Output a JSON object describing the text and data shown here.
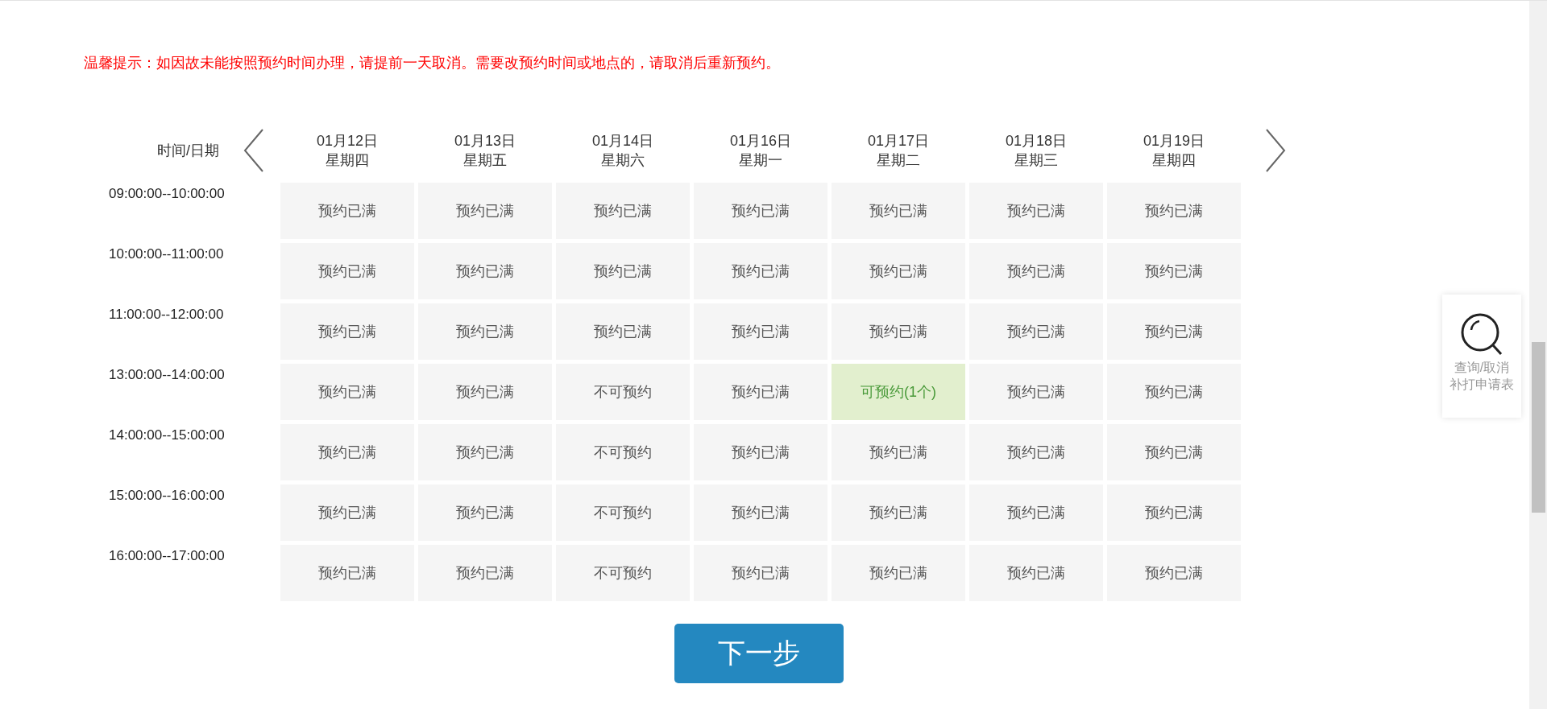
{
  "notice": "温馨提示：如因故未能按照预约时间办理，请提前一天取消。需要改预约时间或地点的，请取消后重新预约。",
  "header_label": "时间/日期",
  "days": [
    {
      "date": "01月12日",
      "weekday": "星期四"
    },
    {
      "date": "01月13日",
      "weekday": "星期五"
    },
    {
      "date": "01月14日",
      "weekday": "星期六"
    },
    {
      "date": "01月16日",
      "weekday": "星期一"
    },
    {
      "date": "01月17日",
      "weekday": "星期二"
    },
    {
      "date": "01月18日",
      "weekday": "星期三"
    },
    {
      "date": "01月19日",
      "weekday": "星期四"
    }
  ],
  "slots": [
    {
      "time": "09:00:00--10:00:00",
      "cells": [
        {
          "text": "预约已满",
          "kind": "full"
        },
        {
          "text": "预约已满",
          "kind": "full"
        },
        {
          "text": "预约已满",
          "kind": "full"
        },
        {
          "text": "预约已满",
          "kind": "full"
        },
        {
          "text": "预约已满",
          "kind": "full"
        },
        {
          "text": "预约已满",
          "kind": "full"
        },
        {
          "text": "预约已满",
          "kind": "full"
        }
      ]
    },
    {
      "time": "10:00:00--11:00:00",
      "cells": [
        {
          "text": "预约已满",
          "kind": "full"
        },
        {
          "text": "预约已满",
          "kind": "full"
        },
        {
          "text": "预约已满",
          "kind": "full"
        },
        {
          "text": "预约已满",
          "kind": "full"
        },
        {
          "text": "预约已满",
          "kind": "full"
        },
        {
          "text": "预约已满",
          "kind": "full"
        },
        {
          "text": "预约已满",
          "kind": "full"
        }
      ]
    },
    {
      "time": "11:00:00--12:00:00",
      "cells": [
        {
          "text": "预约已满",
          "kind": "full"
        },
        {
          "text": "预约已满",
          "kind": "full"
        },
        {
          "text": "预约已满",
          "kind": "full"
        },
        {
          "text": "预约已满",
          "kind": "full"
        },
        {
          "text": "预约已满",
          "kind": "full"
        },
        {
          "text": "预约已满",
          "kind": "full"
        },
        {
          "text": "预约已满",
          "kind": "full"
        }
      ]
    },
    {
      "time": "13:00:00--14:00:00",
      "cells": [
        {
          "text": "预约已满",
          "kind": "full"
        },
        {
          "text": "预约已满",
          "kind": "full"
        },
        {
          "text": "不可预约",
          "kind": "closed"
        },
        {
          "text": "预约已满",
          "kind": "full"
        },
        {
          "text": "可预约(1个)",
          "kind": "open"
        },
        {
          "text": "预约已满",
          "kind": "full"
        },
        {
          "text": "预约已满",
          "kind": "full"
        }
      ]
    },
    {
      "time": "14:00:00--15:00:00",
      "cells": [
        {
          "text": "预约已满",
          "kind": "full"
        },
        {
          "text": "预约已满",
          "kind": "full"
        },
        {
          "text": "不可预约",
          "kind": "closed"
        },
        {
          "text": "预约已满",
          "kind": "full"
        },
        {
          "text": "预约已满",
          "kind": "full"
        },
        {
          "text": "预约已满",
          "kind": "full"
        },
        {
          "text": "预约已满",
          "kind": "full"
        }
      ]
    },
    {
      "time": "15:00:00--16:00:00",
      "cells": [
        {
          "text": "预约已满",
          "kind": "full"
        },
        {
          "text": "预约已满",
          "kind": "full"
        },
        {
          "text": "不可预约",
          "kind": "closed"
        },
        {
          "text": "预约已满",
          "kind": "full"
        },
        {
          "text": "预约已满",
          "kind": "full"
        },
        {
          "text": "预约已满",
          "kind": "full"
        },
        {
          "text": "预约已满",
          "kind": "full"
        }
      ]
    },
    {
      "time": "16:00:00--17:00:00",
      "cells": [
        {
          "text": "预约已满",
          "kind": "full"
        },
        {
          "text": "预约已满",
          "kind": "full"
        },
        {
          "text": "不可预约",
          "kind": "closed"
        },
        {
          "text": "预约已满",
          "kind": "full"
        },
        {
          "text": "预约已满",
          "kind": "full"
        },
        {
          "text": "预约已满",
          "kind": "full"
        },
        {
          "text": "预约已满",
          "kind": "full"
        }
      ]
    }
  ],
  "next_button": "下一步",
  "side_widget": {
    "line_1": "查询/取消",
    "line_2": "补打申请表"
  }
}
